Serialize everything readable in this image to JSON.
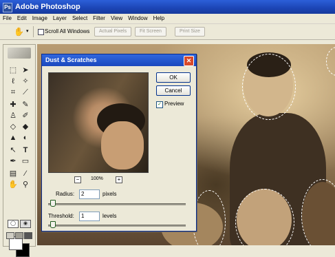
{
  "window": {
    "title": "Adobe Photoshop",
    "icon": "Ps"
  },
  "menu": [
    "File",
    "Edit",
    "Image",
    "Layer",
    "Select",
    "Filter",
    "View",
    "Window",
    "Help"
  ],
  "options_bar": {
    "scroll_all_windows": "Scroll All Windows",
    "buttons": [
      "Actual Pixels",
      "Fit Screen",
      "Print Size"
    ]
  },
  "dialog": {
    "title": "Dust & Scratches",
    "ok": "OK",
    "cancel": "Cancel",
    "preview_label": "Preview",
    "preview_checked": true,
    "zoom": "100%",
    "zoom_out_symbol": "−",
    "zoom_in_symbol": "+",
    "radius": {
      "label": "Radius:",
      "value": "2",
      "unit": "pixels"
    },
    "threshold": {
      "label": "Threshold:",
      "value": "1",
      "unit": "levels"
    }
  },
  "toolbox": {
    "tools": [
      "marquee-tool",
      "move-tool",
      "lasso-tool",
      "magic-wand-tool",
      "crop-tool",
      "slice-tool",
      "healing-brush-tool",
      "brush-tool",
      "clone-stamp-tool",
      "history-brush-tool",
      "eraser-tool",
      "fill-tool",
      "blur-tool",
      "dodge-tool",
      "path-select-tool",
      "type-tool",
      "pen-tool",
      "shape-tool",
      "notes-tool",
      "eyedropper-tool",
      "hand-tool",
      "zoom-tool"
    ]
  },
  "colors": {
    "foreground": "#ffffff",
    "background": "#000000",
    "titlebar": "#1c45b4"
  }
}
